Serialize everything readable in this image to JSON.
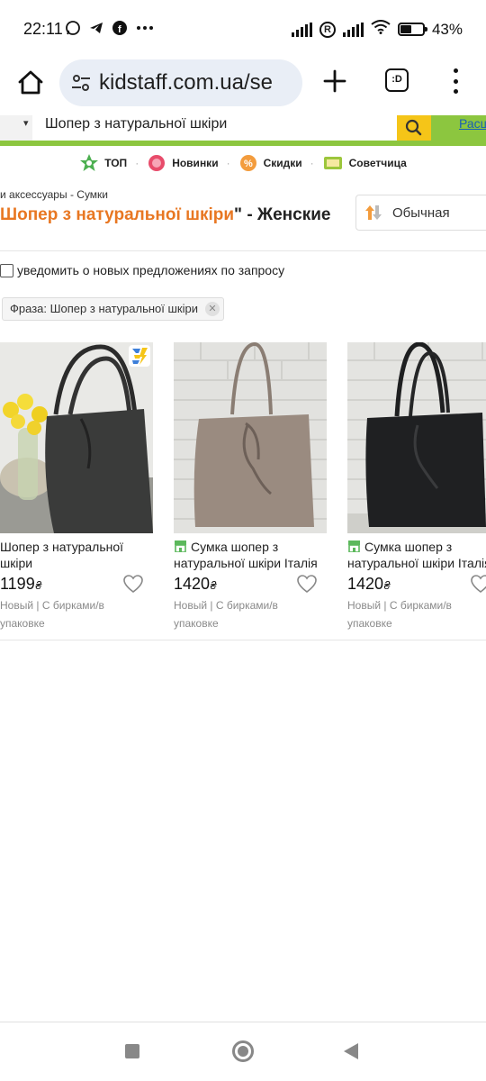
{
  "status_bar": {
    "time": "22:11",
    "battery_percent": "43%",
    "icons": [
      "whatsapp-icon",
      "telegram-icon",
      "facebook-icon",
      "more-dots-icon",
      "signal-icon",
      "roaming-icon",
      "wifi-icon",
      "battery-icon"
    ]
  },
  "browser": {
    "url": "kidstaff.com.ua/se",
    "tabs_label": ":D"
  },
  "site": {
    "search_value": "Шопер з натуральної шкіри",
    "login_link": "Расш",
    "nav": [
      {
        "label": "ТОП",
        "icon": "top-badge-icon"
      },
      {
        "label": "Новинки",
        "icon": "new-badge-icon"
      },
      {
        "label": "Скидки",
        "icon": "discount-badge-icon"
      },
      {
        "label": "Советчица",
        "icon": "advisor-badge-icon"
      }
    ]
  },
  "page": {
    "breadcrumb": "и аксессуары - Сумки",
    "title_highlight": "Шопер з натуральної шкіри",
    "title_rest": "\" - Женские",
    "sort_label": "Обычная",
    "notify_label": "уведомить о новых предложениях по запросу",
    "phrase_chip": "Фраза: Шопер з натуральної шкіри"
  },
  "products": [
    {
      "title": "Шопер з натуральної шкіри",
      "price": "1199",
      "currency": "₴",
      "condition": "Новый | С бирками/в упаковке",
      "shop_badge": false
    },
    {
      "title": "Сумка шопер з натуральної шкіри Італія",
      "price": "1420",
      "currency": "₴",
      "condition": "Новый | С бирками/в упаковке",
      "shop_badge": true
    },
    {
      "title": "Сумка шопер з натуральної шкіри Італія",
      "price": "1420",
      "currency": "₴",
      "condition": "Новый | С бирками/в упаковке",
      "shop_badge": true
    }
  ],
  "colors": {
    "accent_orange": "#e87722",
    "strip_green": "#8cc63f",
    "search_yellow": "#f5c518"
  }
}
